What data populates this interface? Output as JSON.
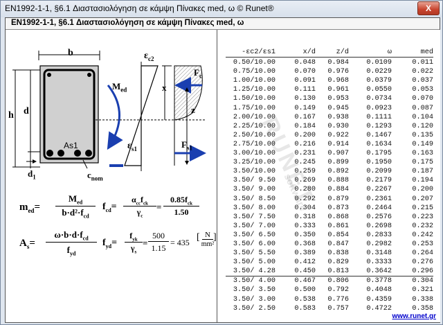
{
  "window": {
    "title": "EN1992-1-1, §6.1  Διαστασιολόγηση σε κάμψη Πίνακες med, ω © Runet®",
    "close_label": "X"
  },
  "panel": {
    "header": "EN1992-1-1, §6.1  Διαστασιολόγηση σε κάμψη Πίνακες med, ω"
  },
  "diagram": {
    "b": "b",
    "h": "h",
    "d": "d",
    "d1": "d",
    "d1_sub": "1",
    "as1": "As1",
    "cnom": "c",
    "cnom_sub": "nom",
    "med": "M",
    "med_sub": "ed",
    "ec2": "ε",
    "ec2_sub": "c2",
    "es1": "ε",
    "es1_sub": "s1",
    "x": "x",
    "z": "z",
    "fc": "F",
    "fc_sub": "c",
    "fs1": "F",
    "fs1_sub": "s1"
  },
  "formulas": {
    "med_lhs": "m",
    "med_lhs_sub": "ed",
    "med_num": "M",
    "med_num_sub": "ed",
    "med_den": "b·d²·f",
    "med_den_sub": "cd",
    "fcd_lhs": "f",
    "fcd_lhs_sub": "cd",
    "fcd_num": "α",
    "fcd_num_sub": "cc",
    "fcd_num2": "f",
    "fcd_num2_sub": "ck",
    "fcd_den": "γ",
    "fcd_den_sub": "c",
    "fcd_num3": "0.85f",
    "fcd_num3_sub": "ck",
    "fcd_den3": "1.50",
    "as_lhs": "A",
    "as_lhs_sub": "s",
    "as_num": "ω·b·d·f",
    "as_num_sub": "cd",
    "as_den": "f",
    "as_den_sub": "yd",
    "fyd_lhs": "f",
    "fyd_lhs_sub": "yd",
    "fyd_num": "f",
    "fyd_num_sub": "yk",
    "fyd_den": "γ",
    "fyd_den_sub": "s",
    "fyd_num2": "500",
    "fyd_den2": "1.15",
    "fyd_result": "= 435",
    "fyd_unit_num": "N",
    "fyd_unit_den": "mm²"
  },
  "watermark": {
    "main": "RUNET",
    "sub": "software"
  },
  "table": {
    "headers": [
      "-εc2/εs1",
      "x/d",
      "z/d",
      "ω",
      "med"
    ],
    "rows": [
      [
        "0.50/10.00",
        "0.048",
        "0.984",
        "0.0109",
        "0.011"
      ],
      [
        "0.75/10.00",
        "0.070",
        "0.976",
        "0.0229",
        "0.022"
      ],
      [
        "1.00/10.00",
        "0.091",
        "0.968",
        "0.0379",
        "0.037"
      ],
      [
        "1.25/10.00",
        "0.111",
        "0.961",
        "0.0550",
        "0.053"
      ],
      [
        "1.50/10.00",
        "0.130",
        "0.953",
        "0.0734",
        "0.070"
      ],
      [
        "1.75/10.00",
        "0.149",
        "0.945",
        "0.0923",
        "0.087"
      ],
      [
        "2.00/10.00",
        "0.167",
        "0.938",
        "0.1111",
        "0.104"
      ],
      [
        "2.25/10.00",
        "0.184",
        "0.930",
        "0.1293",
        "0.120"
      ],
      [
        "2.50/10.00",
        "0.200",
        "0.922",
        "0.1467",
        "0.135"
      ],
      [
        "2.75/10.00",
        "0.216",
        "0.914",
        "0.1634",
        "0.149"
      ],
      [
        "3.00/10.00",
        "0.231",
        "0.907",
        "0.1795",
        "0.163"
      ],
      [
        "3.25/10.00",
        "0.245",
        "0.899",
        "0.1950",
        "0.175"
      ],
      [
        "3.50/10.00",
        "0.259",
        "0.892",
        "0.2099",
        "0.187"
      ],
      [
        "3.50/ 9.50",
        "0.269",
        "0.888",
        "0.2179",
        "0.194"
      ],
      [
        "3.50/ 9.00",
        "0.280",
        "0.884",
        "0.2267",
        "0.200"
      ],
      [
        "3.50/ 8.50",
        "0.292",
        "0.879",
        "0.2361",
        "0.207"
      ],
      [
        "3.50/ 8.00",
        "0.304",
        "0.873",
        "0.2464",
        "0.215"
      ],
      [
        "3.50/ 7.50",
        "0.318",
        "0.868",
        "0.2576",
        "0.223"
      ],
      [
        "3.50/ 7.00",
        "0.333",
        "0.861",
        "0.2698",
        "0.232"
      ],
      [
        "3.50/ 6.50",
        "0.350",
        "0.854",
        "0.2833",
        "0.242"
      ],
      [
        "3.50/ 6.00",
        "0.368",
        "0.847",
        "0.2982",
        "0.253"
      ],
      [
        "3.50/ 5.50",
        "0.389",
        "0.838",
        "0.3148",
        "0.264"
      ],
      [
        "3.50/ 5.00",
        "0.412",
        "0.829",
        "0.3333",
        "0.276"
      ],
      [
        "3.50/ 4.28",
        "0.450",
        "0.813",
        "0.3642",
        "0.296"
      ]
    ],
    "rows2": [
      [
        "3.50/ 4.00",
        "0.467",
        "0.806",
        "0.3778",
        "0.304"
      ],
      [
        "3.50/ 3.50",
        "0.500",
        "0.792",
        "0.4048",
        "0.321"
      ],
      [
        "3.50/ 3.00",
        "0.538",
        "0.776",
        "0.4359",
        "0.338"
      ],
      [
        "3.50/ 2.50",
        "0.583",
        "0.757",
        "0.4722",
        "0.358"
      ]
    ]
  },
  "footer": {
    "link": "www.runet.gr"
  }
}
